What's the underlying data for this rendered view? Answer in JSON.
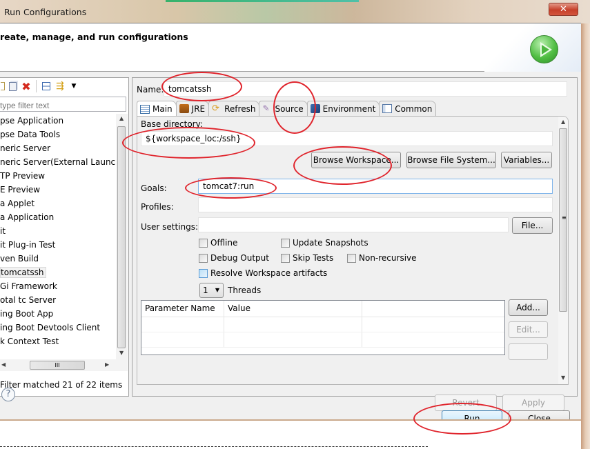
{
  "window": {
    "title": "Run Configurations",
    "close_icon": "close-icon"
  },
  "header": {
    "title": "reate, manage, and run configurations",
    "logo_icon": "run-play-icon"
  },
  "left_panel": {
    "toolbar_icons": [
      "new-config-icon",
      "duplicate-icon",
      "delete-icon",
      "collapse-all-icon",
      "filter-icon",
      "dropdown-icon"
    ],
    "filter_placeholder": "type filter text",
    "tree_items": [
      {
        "label": "pse Application"
      },
      {
        "label": "pse Data Tools"
      },
      {
        "label": "neric Server"
      },
      {
        "label": "neric Server(External Launch)"
      },
      {
        "label": "TP Preview"
      },
      {
        "label": "E Preview"
      },
      {
        "label": "a Applet"
      },
      {
        "label": "a Application"
      },
      {
        "label": "it"
      },
      {
        "label": "it Plug-in Test"
      },
      {
        "label": "ven Build"
      },
      {
        "label": "tomcatssh",
        "selected": true
      },
      {
        "label": "Gi Framework"
      },
      {
        "label": "otal tc Server"
      },
      {
        "label": "ing Boot App"
      },
      {
        "label": "ing Boot Devtools Client"
      },
      {
        "label": "k Context Test"
      }
    ],
    "status": "Filter matched 21 of 22 items"
  },
  "config": {
    "name_label": "Name:",
    "name_value": "tomcatssh",
    "tabs": [
      {
        "label": "Main",
        "icon": "main-tab-icon",
        "active": true
      },
      {
        "label": "JRE",
        "icon": "jre-icon"
      },
      {
        "label": "Refresh",
        "icon": "refresh-icon"
      },
      {
        "label": "Source",
        "icon": "source-icon"
      },
      {
        "label": "Environment",
        "icon": "environment-icon"
      },
      {
        "label": "Common",
        "icon": "common-icon"
      }
    ],
    "main": {
      "base_dir_label": "Base directory:",
      "base_dir_value": "${workspace_loc:/ssh}",
      "browse_workspace": "Browse Workspace...",
      "browse_fs": "Browse File System...",
      "variables": "Variables...",
      "goals_label": "Goals:",
      "goals_value": "tomcat7:run",
      "profiles_label": "Profiles:",
      "profiles_value": "",
      "user_settings_label": "User settings:",
      "user_settings_value": "",
      "file_button": "File...",
      "checkboxes": {
        "offline": {
          "label": "Offline",
          "checked": false
        },
        "update_snapshots": {
          "label": "Update Snapshots",
          "checked": false
        },
        "debug_output": {
          "label": "Debug Output",
          "checked": false
        },
        "skip_tests": {
          "label": "Skip Tests",
          "checked": false
        },
        "non_recursive": {
          "label": "Non-recursive",
          "checked": false
        },
        "resolve_workspace": {
          "label": "Resolve Workspace artifacts",
          "checked": false
        }
      },
      "threads_value": "1",
      "threads_label": "Threads",
      "param_table": {
        "columns": [
          "Parameter Name",
          "Value"
        ],
        "rows": []
      },
      "add_button": "Add...",
      "edit_button": "Edit..."
    },
    "revert": "Revert",
    "apply": "Apply"
  },
  "footer": {
    "help_icon": "help-icon",
    "run": "Run",
    "close": "Close"
  },
  "colors": {
    "annotation": "#e0242c",
    "default_button": "#bee6fd"
  }
}
